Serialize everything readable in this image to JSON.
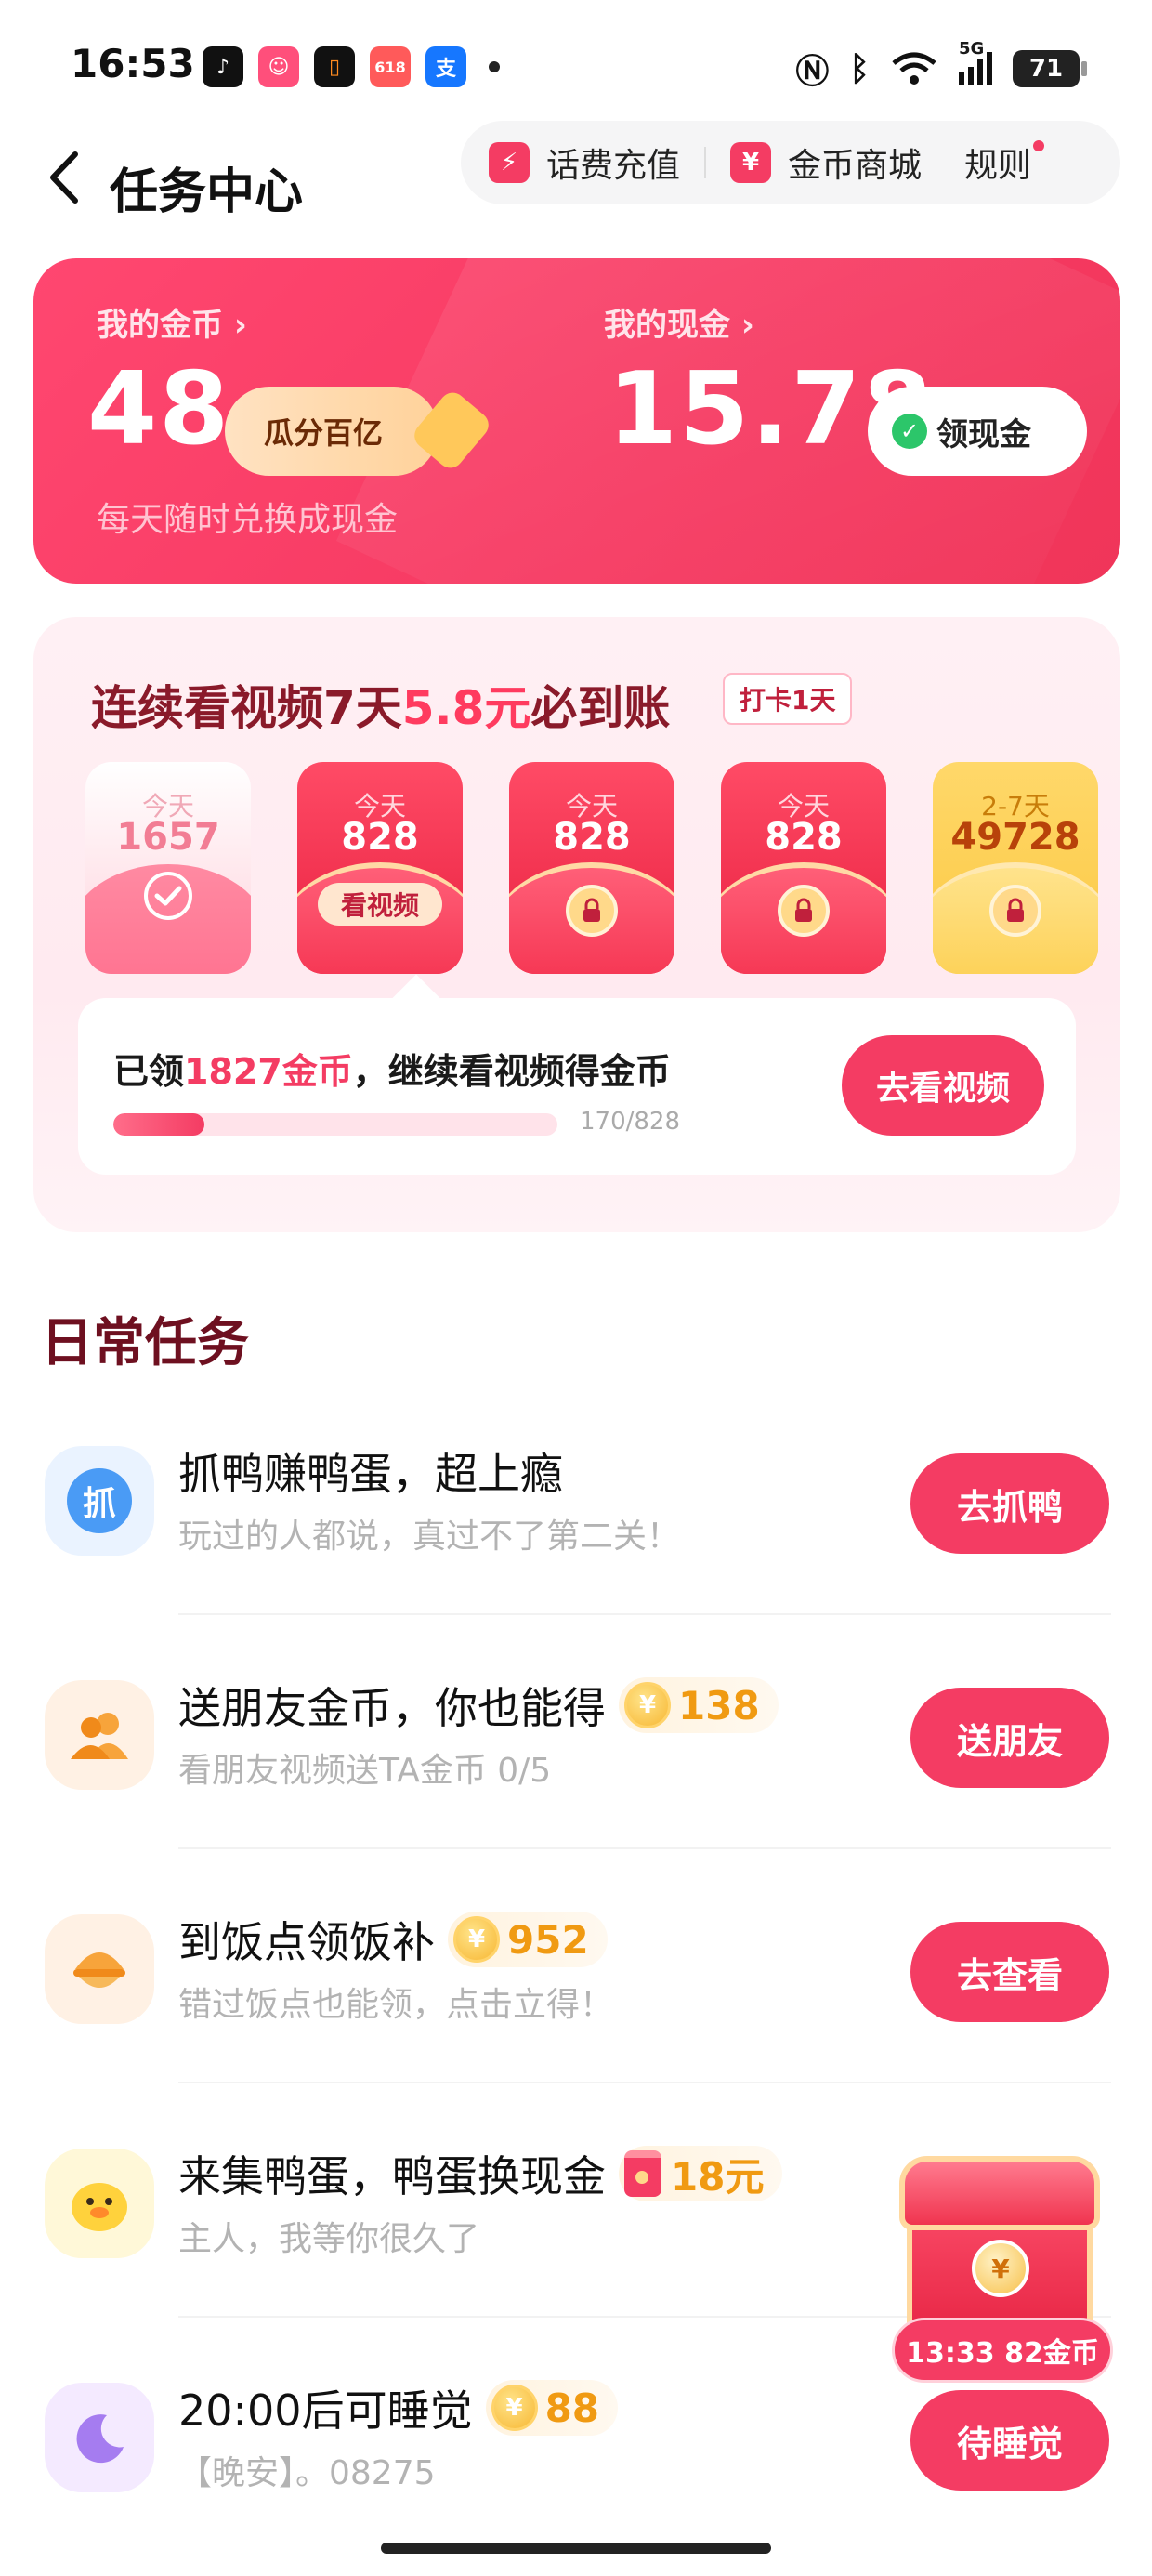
{
  "status_bar": {
    "time": "16:53",
    "apps": [
      {
        "name": "tiktok-app-icon",
        "glyph": "♪",
        "color": "#111111"
      },
      {
        "name": "cartoon-app-icon",
        "glyph": "☺",
        "color": "#ff4f7b"
      },
      {
        "name": "orange-app-icon",
        "glyph": "▯",
        "color": "#111111"
      },
      {
        "name": "shop-618-app-icon",
        "glyph": "618",
        "color": "#ff5a5a"
      },
      {
        "name": "alipay-app-icon",
        "glyph": "支",
        "color": "#1677ff"
      }
    ],
    "signal_label": "5G",
    "battery": "71"
  },
  "header": {
    "title": "任务中心",
    "recharge_label": "话费充值",
    "mall_label": "金币商城",
    "rules_label": "规则",
    "recharge_icon": "⚡",
    "mall_icon": "¥"
  },
  "coin_card": {
    "coins_label": "我的金币 ›",
    "coins_value": "48",
    "guafen_label": "瓜分百亿",
    "coins_subtitle": "每天随时兑换成现金",
    "cash_label": "我的现金 ›",
    "cash_value": "15.78",
    "withdraw_label": "领现金"
  },
  "streak": {
    "title_prefix": "连续看视频7天",
    "title_highlight": "5.8元",
    "title_suffix": "必到账",
    "checkin_tag": "打卡1天",
    "envelopes": [
      {
        "label": "今天",
        "amount": "1657",
        "style": "done"
      },
      {
        "label": "今天",
        "amount": "828",
        "style": "red",
        "tag": "看视频"
      },
      {
        "label": "今天",
        "amount": "828",
        "style": "red"
      },
      {
        "label": "今天",
        "amount": "828",
        "style": "red"
      },
      {
        "label": "2-7天",
        "amount": "49728",
        "style": "gold"
      }
    ],
    "progress_prefix": "已领",
    "progress_highlight": "1827金币",
    "progress_suffix": "，继续看视频得金币",
    "progress_count": "170/828",
    "progress_fraction": 0.205,
    "button_label": "去看视频"
  },
  "daily": {
    "section_title": "日常任务",
    "tasks": [
      {
        "title": "抓鸭赚鸭蛋，超上瘾",
        "desc": "玩过的人都说，真过不了第二关！",
        "button": "去抓鸭",
        "icon_glyph": "抓",
        "reward": ""
      },
      {
        "title": "送朋友金币，你也能得",
        "desc": "看朋友视频送TA金币 0/5",
        "button": "送朋友",
        "icon_glyph": "👥",
        "reward": "138"
      },
      {
        "title": "到饭点领饭补",
        "desc": "错过饭点也能领，点击立得！",
        "button": "去查看",
        "icon_glyph": "◒",
        "reward": "952"
      },
      {
        "title": "来集鸭蛋，鸭蛋换现金",
        "desc": "主人，我等你很久了",
        "button": "",
        "icon_glyph": "🐥",
        "reward": "18元"
      },
      {
        "title": "20:00后可睡觉",
        "desc": "【晚安】。08275",
        "button": "待睡觉",
        "icon_glyph": "☾",
        "reward": "88"
      }
    ]
  },
  "treasure": {
    "timer_label": "13:33 82金币",
    "coin_glyph": "¥"
  },
  "colors": {
    "accent": "#f43c63",
    "gold": "#f09a12",
    "title_dark": "#6e1020"
  }
}
